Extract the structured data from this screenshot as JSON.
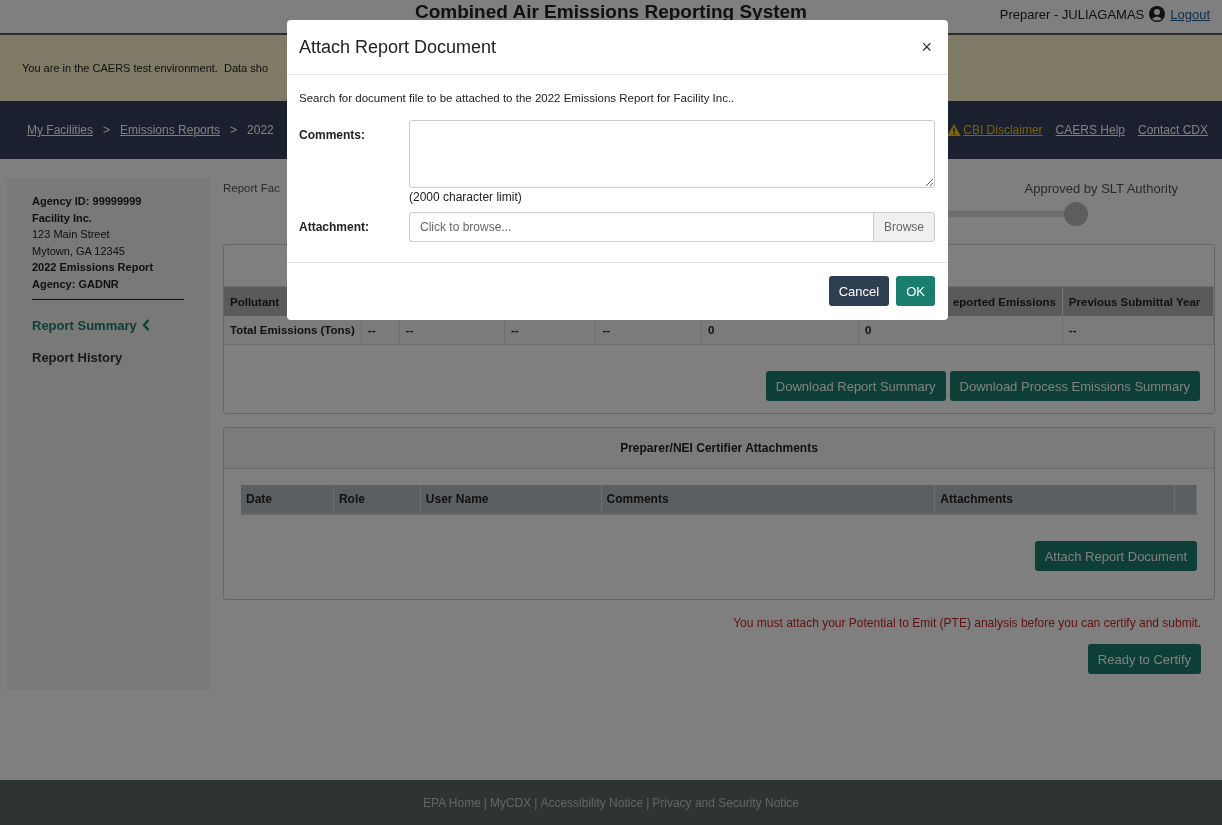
{
  "header": {
    "title": "Combined Air Emissions Reporting System",
    "user": "Preparer - JULIAGAMAS",
    "logout": "Logout"
  },
  "banner": {
    "text": "You are in the CAERS test environment.  Data sho"
  },
  "breadcrumb": {
    "separator": ">",
    "items": [
      {
        "label": "My Facilities",
        "link": true
      },
      {
        "label": "Emissions Reports",
        "link": true
      },
      {
        "label": "2022",
        "link": false
      }
    ]
  },
  "nav_links": [
    {
      "label": "CBI Disclaimer",
      "kind": "warning"
    },
    {
      "label": "CAERS Help",
      "kind": "plain"
    },
    {
      "label": "Contact CDX",
      "kind": "plain"
    }
  ],
  "sidebar": {
    "details": [
      {
        "text": "Agency ID: 99999999",
        "bold": true
      },
      {
        "text": "Facility Inc.",
        "bold": true
      },
      {
        "text": "123 Main Street",
        "bold": false
      },
      {
        "text": "Mytown, GA 12345",
        "bold": false
      },
      {
        "text": "2022 Emissions Report",
        "bold": true
      },
      {
        "text": "Agency: GADNR",
        "bold": true
      }
    ],
    "items": [
      {
        "label": "Report Summary",
        "selected": true
      },
      {
        "label": "Report History",
        "selected": false
      }
    ]
  },
  "page_heading": "Report Fac",
  "progress": {
    "step": "Approved by SLT Authority"
  },
  "summary_table": {
    "columns": [
      {
        "label": "Pollutant"
      },
      {},
      {},
      {},
      {},
      {},
      {
        "label": "eported Emissions"
      },
      {
        "label": "Previous Submittal Year"
      }
    ],
    "rows": [
      [
        "Total Emissions (Tons)",
        "--",
        "--",
        "--",
        "--",
        "0",
        "0",
        "--"
      ]
    ],
    "buttons": [
      "Download Report Summary",
      "Download Process Emissions Summary"
    ]
  },
  "attachments": {
    "title": "Preparer/NEI Certifier Attachments",
    "columns": [
      "Date",
      "Role",
      "User Name",
      "Comments",
      "Attachments"
    ],
    "button": "Attach Report Document"
  },
  "warning": "You must attach your Potential to Emit (PTE) analysis before you can certify and submit.",
  "certify_button": "Ready to Certify",
  "footer": {
    "separator": "|",
    "links": [
      "EPA Home",
      "MyCDX",
      "Accessibility Notice",
      "Privacy and Security Notice"
    ]
  },
  "modal": {
    "title": "Attach Report Document",
    "close": "×",
    "description": "Search for document file to be attached to the 2022 Emissions Report for Facility Inc..",
    "comments_label": "Comments:",
    "comments_hint": "(2000 character limit)",
    "attachment_label": "Attachment:",
    "attachment_placeholder": "Click to browse...",
    "browse": "Browse",
    "buttons": [
      {
        "label": "Cancel",
        "kind": "secondary"
      },
      {
        "label": "OK",
        "kind": "primary"
      }
    ]
  }
}
